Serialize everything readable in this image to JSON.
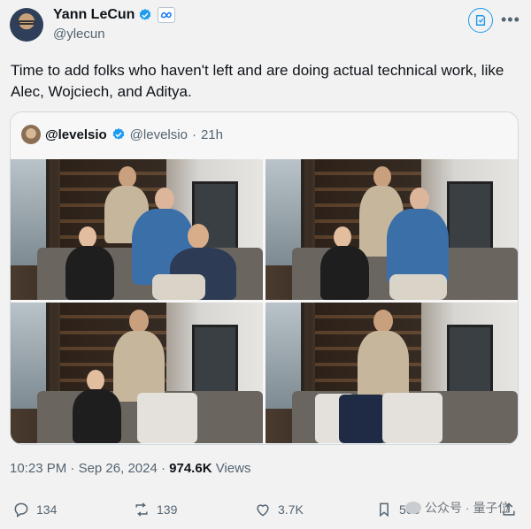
{
  "author": {
    "display_name": "Yann LeCun",
    "handle": "@ylecun"
  },
  "post_text": "Time to add folks who haven't left and are doing actual technical work, like Alec, Wojciech, and Aditya.",
  "quote": {
    "display_name": "@levelsio",
    "handle": "@levelsio",
    "separator": "·",
    "time": "21h"
  },
  "meta": {
    "time": "10:23 PM",
    "separator1": "·",
    "date": "Sep 26, 2024",
    "separator2": "·",
    "views_count": "974.6K",
    "views_label": "Views"
  },
  "actions": {
    "replies": "134",
    "reposts": "139",
    "likes": "3.7K",
    "bookmarks": "508"
  },
  "watermark": "公众号 · 量子位",
  "icons": [
    "verified-badge-icon",
    "meta-affiliation-icon",
    "grok-icon",
    "more-icon",
    "reply-icon",
    "repost-icon",
    "like-icon",
    "bookmark-icon",
    "share-icon"
  ],
  "colors": {
    "accent": "#1d9bf0",
    "text": "#0f1419",
    "muted": "#536471"
  }
}
